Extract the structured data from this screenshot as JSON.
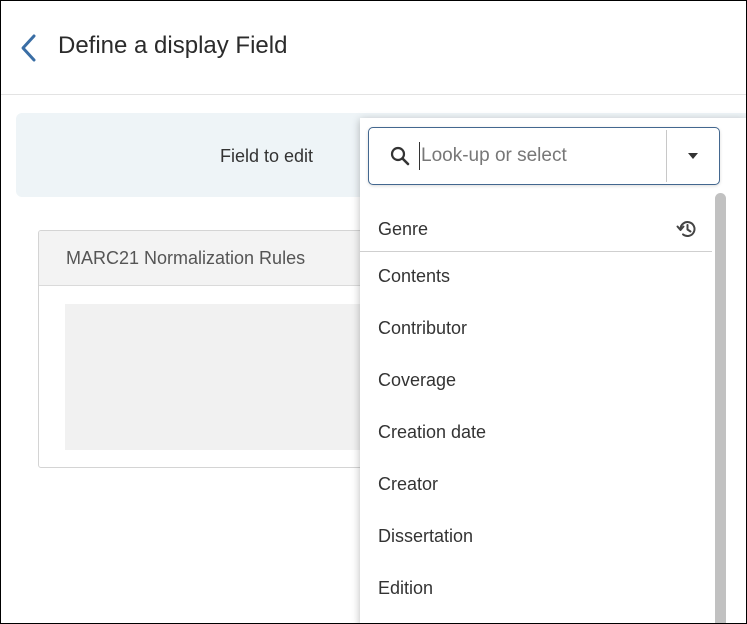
{
  "header": {
    "back_icon": "chevron-left-icon",
    "title": "Define a display Field"
  },
  "field_to_edit": {
    "label": "Field to edit",
    "search_icon": "search-icon",
    "input_value": "",
    "placeholder": "Look-up or select",
    "caret_icon": "caret-down-icon"
  },
  "rules_panel": {
    "title": "MARC21 Normalization Rules"
  },
  "dropdown": {
    "recent": {
      "label": "Genre",
      "icon": "history-icon"
    },
    "options": [
      "Contents",
      "Contributor",
      "Coverage",
      "Creation date",
      "Creator",
      "Dissertation",
      "Edition"
    ]
  },
  "colors": {
    "accent": "#43678f",
    "band_background": "#eef4f7"
  }
}
